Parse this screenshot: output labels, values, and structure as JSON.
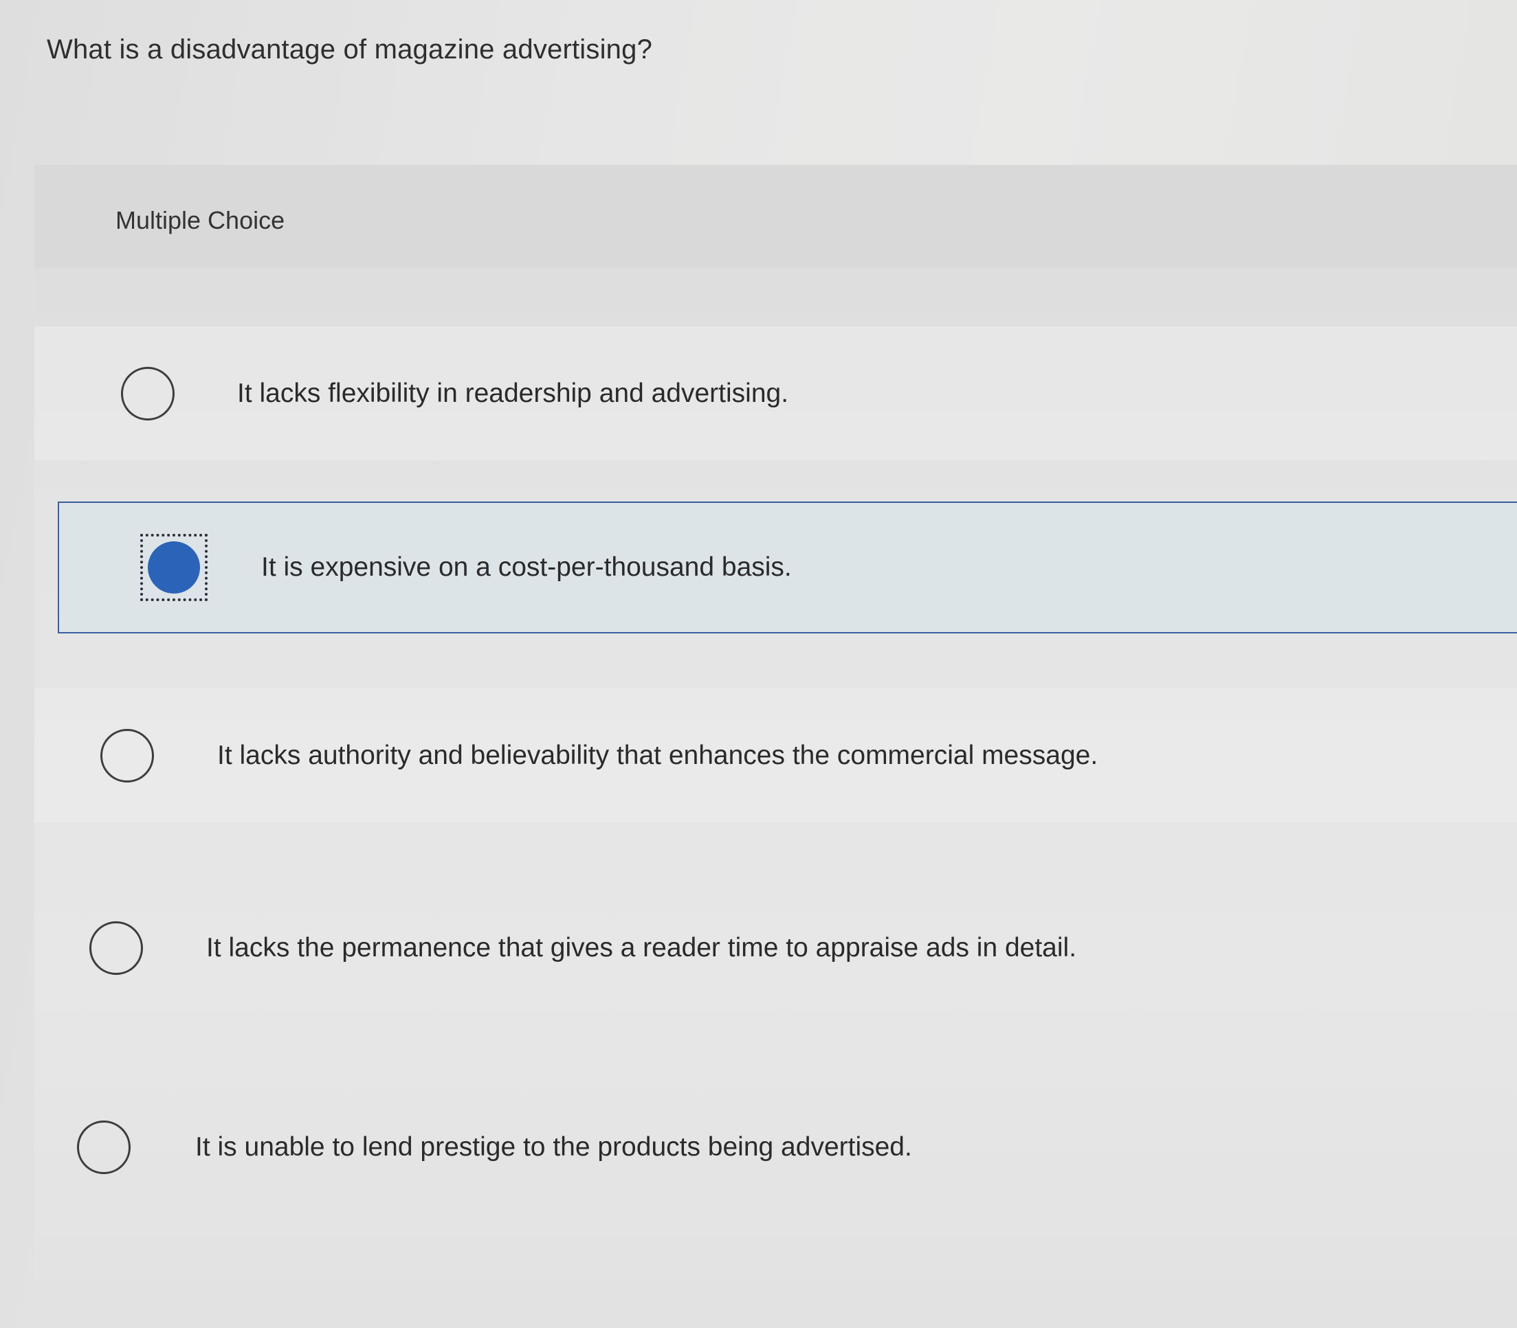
{
  "question": {
    "text": "What is a disadvantage of magazine advertising?"
  },
  "panel": {
    "type_label": "Multiple Choice"
  },
  "options": [
    {
      "label": "It lacks flexibility in readership and advertising.",
      "selected": false
    },
    {
      "label": "It is expensive on a cost-per-thousand basis.",
      "selected": true
    },
    {
      "label": "It lacks authority and believability that enhances the commercial message.",
      "selected": false
    },
    {
      "label": "It lacks the permanence that gives a reader time to appraise ads in detail.",
      "selected": false
    },
    {
      "label": "It is unable to lend prestige to the products being advertised.",
      "selected": false
    }
  ],
  "colors": {
    "selected_fill": "#2b63b8",
    "selected_border": "#3b5ea0",
    "selected_background": "#dde4e8"
  },
  "icons": {
    "unselected": "radio-empty-icon",
    "selected": "radio-filled-icon"
  }
}
